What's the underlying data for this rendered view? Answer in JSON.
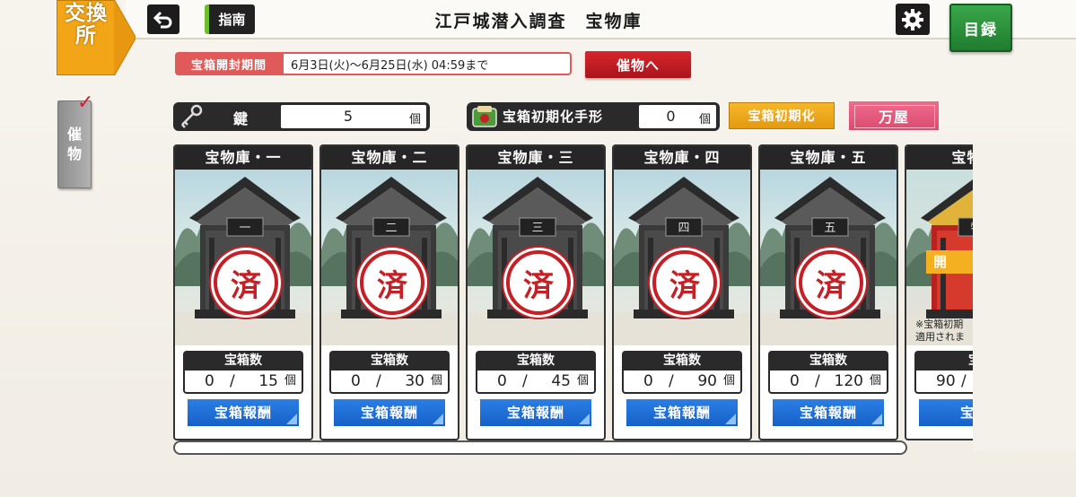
{
  "header": {
    "exchange_label": "交換所",
    "back_icon": "back-arrow-icon",
    "guide_label": "指南",
    "title": "江戸城潜入調査　宝物庫",
    "settings_icon": "gear-icon",
    "catalog_label": "目録"
  },
  "period": {
    "label": "宝箱開封期間",
    "value": "6月3日(火)〜6月25日(水) 04:59まで",
    "goto_label": "催物へ"
  },
  "side_tab": {
    "label_1": "催",
    "label_2": "物",
    "check": "✓"
  },
  "counters": {
    "key": {
      "label": "鍵",
      "value": "5",
      "unit": "個",
      "icon": "key-icon"
    },
    "ticket": {
      "label": "宝箱初期化手形",
      "value": "0",
      "unit": "個",
      "icon": "ticket-icon"
    },
    "reset_label": "宝箱初期化",
    "shop_label": "万屋"
  },
  "vaults": [
    {
      "title": "宝物庫・一",
      "plaque": "一",
      "stamp": "済",
      "count_label": "宝箱数",
      "current": "0",
      "sep": "/",
      "total": "15",
      "unit": "個",
      "reward_label": "宝箱報酬"
    },
    {
      "title": "宝物庫・二",
      "plaque": "二",
      "stamp": "済",
      "count_label": "宝箱数",
      "current": "0",
      "sep": "/",
      "total": "30",
      "unit": "個",
      "reward_label": "宝箱報酬"
    },
    {
      "title": "宝物庫・三",
      "plaque": "三",
      "stamp": "済",
      "count_label": "宝箱数",
      "current": "0",
      "sep": "/",
      "total": "45",
      "unit": "個",
      "reward_label": "宝箱報酬"
    },
    {
      "title": "宝物庫・四",
      "plaque": "四",
      "stamp": "済",
      "count_label": "宝箱数",
      "current": "0",
      "sep": "/",
      "total": "90",
      "unit": "個",
      "reward_label": "宝箱報酬"
    },
    {
      "title": "宝物庫・五",
      "plaque": "五",
      "stamp": "済",
      "count_label": "宝箱数",
      "current": "0",
      "sep": "/",
      "total": "120",
      "unit": "個",
      "reward_label": "宝箱報酬"
    },
    {
      "title": "宝物庫",
      "plaque": "特",
      "open_label": "開",
      "note": "※宝箱初期\n適用されま",
      "count_label": "宝",
      "current": "90",
      "sep": "/",
      "reward_label": "宝箱"
    }
  ],
  "colors": {
    "accent_red": "#c42026",
    "reward_blue": "#1f6fd8",
    "catalog_green": "#2a9240",
    "tab_orange": "#f2a516"
  }
}
